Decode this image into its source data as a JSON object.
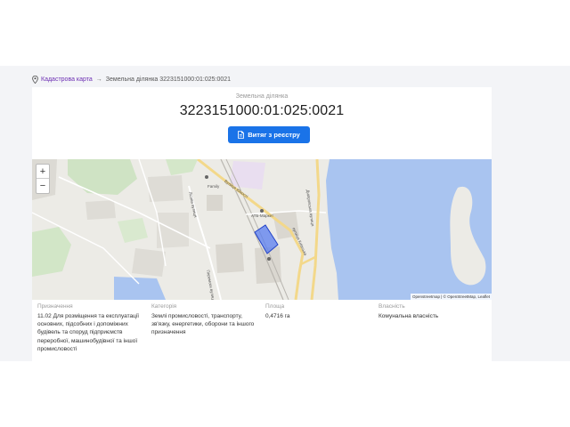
{
  "breadcrumb": {
    "link": "Кадастрова карта",
    "separator": "→",
    "current": "Земельна ділянка 3223151000:01:025:0021"
  },
  "header": {
    "subtitle": "Земельна ділянка",
    "title": "3223151000:01:025:0021",
    "button_label": "Витяг з реєстру"
  },
  "map": {
    "zoom_in": "+",
    "zoom_out": "−",
    "attribution": "Openstreetmap | © OpenStreetMap, Leaflet",
    "labels": {
      "family": "Family",
      "atb": "АТБ-Маркет",
      "street_yunosti": "Вулиця Юності",
      "street_dniprovska": "Дніпровська вулиця",
      "street_kyivska": "вулиця Київська",
      "street_lisova": "Лісова вулиця",
      "street_bottom": "Перемоги вулиця"
    },
    "colors": {
      "water": "#a9c4f0",
      "parcel_fill": "#5a7ef0",
      "parcel_stroke": "#2343c8",
      "road": "#f3d88a"
    }
  },
  "info": {
    "purpose": {
      "label": "Призначення",
      "lines": [
        "11.02 Для розміщення та експлуатації",
        "основних, підсобних і допоміжних",
        "будівель та споруд підприємств",
        "переробної, машинобудівної та іншої",
        "промисловості"
      ]
    },
    "category": {
      "label": "Категорія",
      "lines": [
        "Землі промисловості, транспорту,",
        "зв'язку, енергетики, оборони та іншого",
        "призначення"
      ]
    },
    "area": {
      "label": "Площа",
      "value": "0,4716 га"
    },
    "ownership": {
      "label": "Власність",
      "value": "Комунальна власність"
    }
  }
}
